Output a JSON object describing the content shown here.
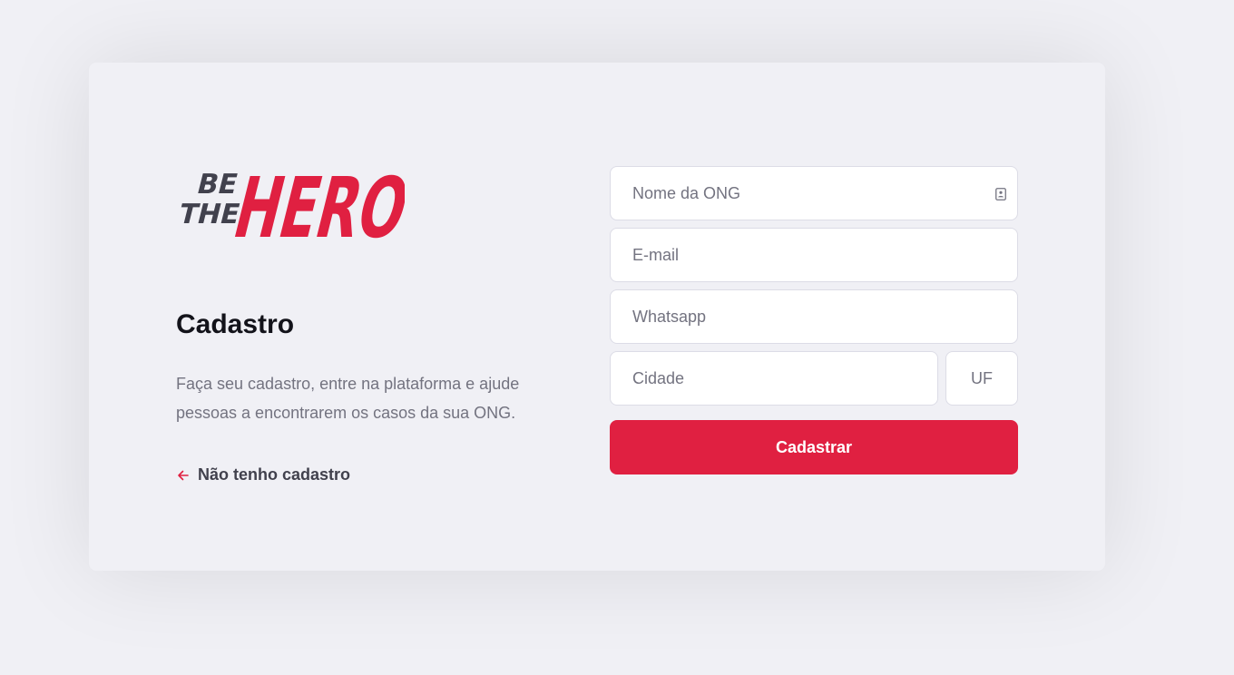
{
  "brand": {
    "logo_text_small_1": "BE",
    "logo_text_small_2": "THE",
    "logo_text_big": "HERO",
    "accent_color": "#e02041",
    "dark_color": "#41414d"
  },
  "intro": {
    "title": "Cadastro",
    "description": "Faça seu cadastro, entre na plataforma e ajude pessoas a encontrarem os casos da sua ONG.",
    "back_link_label": "Não tenho cadastro",
    "back_link_icon": "arrow-left-icon"
  },
  "form": {
    "name_placeholder": "Nome da ONG",
    "name_value": "",
    "name_field_icon": "contact-card-icon",
    "email_placeholder": "E-mail",
    "email_value": "",
    "whatsapp_placeholder": "Whatsapp",
    "whatsapp_value": "",
    "city_placeholder": "Cidade",
    "city_value": "",
    "uf_placeholder": "UF",
    "uf_value": "",
    "submit_label": "Cadastrar"
  }
}
